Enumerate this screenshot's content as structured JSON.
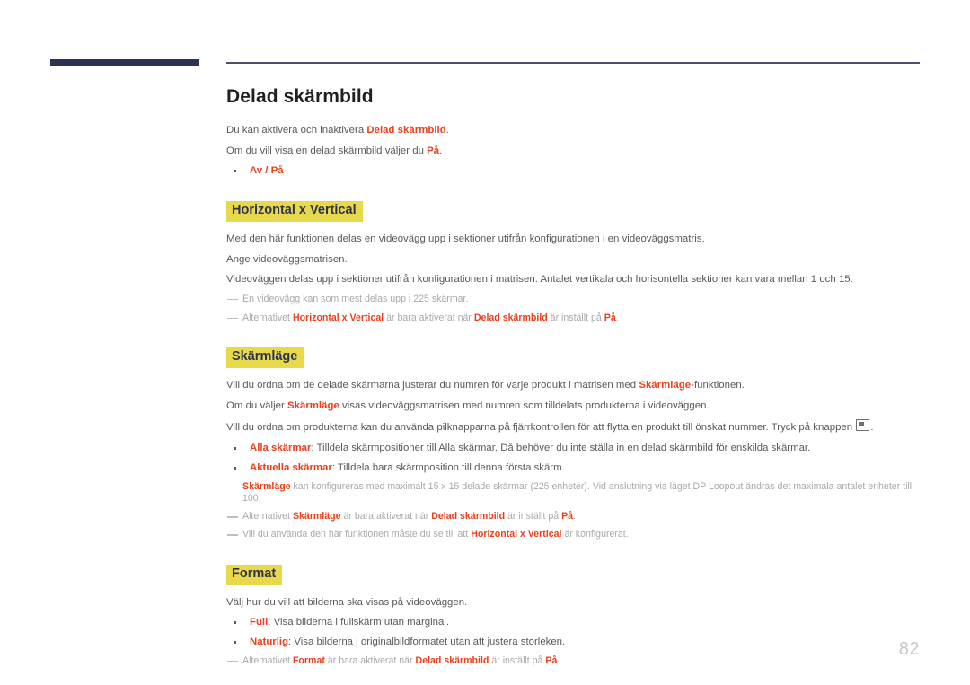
{
  "document": {
    "page_number": "82",
    "title": "Delad skärmbild",
    "accent_highlight": "#e8d84b",
    "accent_red": "#e8401e",
    "header_bar_color": "#2c3352",
    "body_text_color": "#58595b",
    "note_text_color": "#a7a9ac"
  },
  "intro": {
    "line1_before": "Du kan aktivera och inaktivera ",
    "line1_term": "Delad skärmbild",
    "line1_after": ".",
    "line2_before": "Om du vill visa en delad skärmbild väljer du ",
    "line2_term": "På",
    "line2_after": ".",
    "bullet1": "Av / På"
  },
  "sections": [
    {
      "heading": "Horizontal x Vertical",
      "paragraphs": [
        "Med den här funktionen delas en videovägg upp i sektioner utifrån konfigurationen i en videoväggsmatris.",
        "Ange videoväggsmatrisen.",
        "Videoväggen delas upp i sektioner utifrån konfigurationen i matrisen. Antalet vertikala och horisontella sektioner kan vara mellan 1 och 15."
      ],
      "notes": [
        {
          "parts": [
            {
              "t": "En videovägg kan som mest delas upp i 225 skärmar.",
              "style": "plain"
            }
          ]
        },
        {
          "parts": [
            {
              "t": "Alternativet ",
              "style": "plain"
            },
            {
              "t": "Horizontal x Vertical",
              "style": "red"
            },
            {
              "t": " är bara aktiverat när ",
              "style": "plain"
            },
            {
              "t": "Delad skärmbild",
              "style": "red"
            },
            {
              "t": " är inställt på ",
              "style": "plain"
            },
            {
              "t": "På",
              "style": "red"
            },
            {
              "t": ".",
              "style": "plain"
            }
          ]
        }
      ]
    },
    {
      "heading": "Skärmläge",
      "paragraphs": [],
      "notes": []
    },
    {
      "heading": "Format",
      "paragraphs": [],
      "notes": []
    }
  ],
  "skarmlage": {
    "p1_a": "Vill du ordna om de delade skärmarna justerar du numren för varje produkt i matrisen med ",
    "p1_term": "Skärmläge",
    "p1_b": "-funktionen.",
    "p2_a": "Om du väljer ",
    "p2_term": "Skärmläge",
    "p2_b": " visas videoväggsmatrisen med numren som tilldelats produkterna i videoväggen.",
    "p3_a": "Vill du ordna om produkterna kan du använda pilknapparna på fjärrkontrollen för att flytta en produkt till önskat nummer. Tryck på knappen ",
    "p3_b": ".",
    "bullets": [
      {
        "term": "Alla skärmar",
        "rest": ": Tilldela skärmpositioner till Alla skärmar. Då behöver du inte ställa in en delad skärmbild för enskilda skärmar."
      },
      {
        "term": "Aktuella skärmar",
        "rest": ": Tilldela bara skärmposition till denna första skärm."
      }
    ],
    "note1_term": "Skärmläge",
    "note1_rest": " kan konfigureras med maximalt 15 x 15 delade skärmar (225 enheter). Vid anslutning via läget DP Loopout ändras det maximala antalet enheter till 100.",
    "note2_a": "Alternativet ",
    "note2_term1": "Skärmläge",
    "note2_b": " är bara aktiverat när ",
    "note2_term2": "Delad skärmbild",
    "note2_c": " är inställt på ",
    "note2_term3": "På",
    "note2_d": ".",
    "note3_a": "Vill du använda den här funktionen måste du se till att ",
    "note3_term": "Horizontal x Vertical",
    "note3_b": " är konfigurerat."
  },
  "format": {
    "p1": "Välj hur du vill att bilderna ska visas på videoväggen.",
    "bullets": [
      {
        "term": "Full",
        "rest": ": Visa bilderna i fullskärm utan marginal."
      },
      {
        "term": "Naturlig",
        "rest": ": Visa bilderna i originalbildformatet utan att justera storleken."
      }
    ],
    "note_a": "Alternativet ",
    "note_term1": "Format",
    "note_b": " är bara aktiverat när ",
    "note_term2": "Delad skärmbild",
    "note_c": " är inställt på ",
    "note_term3": "På",
    "note_d": "."
  },
  "icons": {
    "enter_key": "enter-key-icon"
  }
}
